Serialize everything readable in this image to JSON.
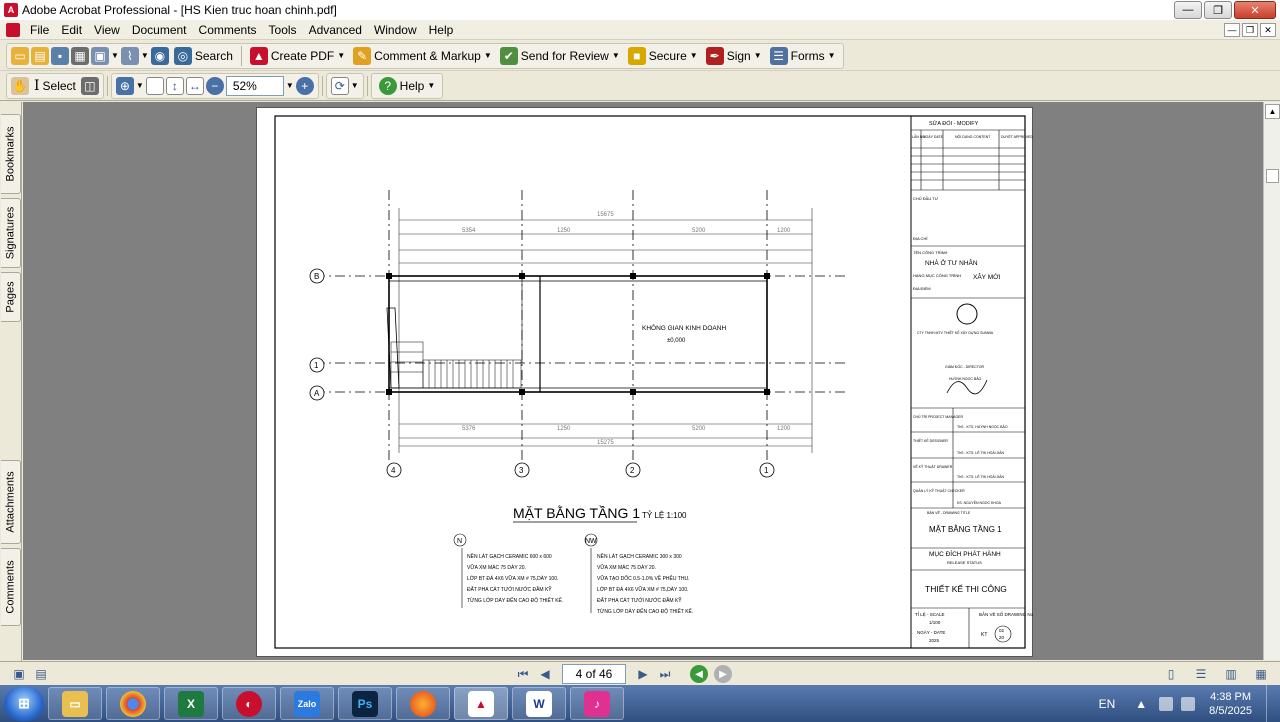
{
  "window": {
    "title": "Adobe Acrobat Professional - [HS Kien truc hoan chinh.pdf]",
    "min_glyph": "—",
    "max_glyph": "❐",
    "close_glyph": "✕"
  },
  "menu": [
    "File",
    "Edit",
    "View",
    "Document",
    "Comments",
    "Tools",
    "Advanced",
    "Window",
    "Help"
  ],
  "toolbar1": {
    "search": "Search",
    "create_pdf": "Create PDF",
    "comment_markup": "Comment & Markup",
    "send_review": "Send for Review",
    "secure": "Secure",
    "sign": "Sign",
    "forms": "Forms"
  },
  "toolbar2": {
    "select": "Select",
    "zoom_value": "52%",
    "help": "Help"
  },
  "left_tabs": [
    "Bookmarks",
    "Signatures",
    "Pages",
    "Attachments",
    "Comments"
  ],
  "status": {
    "page_indicator": "4 of 46"
  },
  "drawing": {
    "plan_title": "MẶT BẰNG TẦNG 1",
    "scale_label": "TỶ LỆ 1:100",
    "room_label": "KHÔNG GIAN KINH DOANH",
    "room_level": "±0,000",
    "total_dim_top": "15675",
    "total_dim_bottom": "15275",
    "dims_top": [
      "5354",
      "1250",
      "5200",
      "1200"
    ],
    "dims_bottom": [
      "5376",
      "1250",
      "5200",
      "1200"
    ],
    "axis_numbers": [
      "4",
      "3",
      "2",
      "1"
    ],
    "axis_letters": [
      "B",
      "1",
      "A"
    ],
    "legend_n_tag": "N",
    "legend_n": [
      "NỀN LÁT GẠCH CERAMIC 600 x 600",
      "VỮA XM MÁC 75 DÀY 20.",
      "LỚP BT ĐÁ 4X6 VỮA XM # 75,DÀY 100.",
      "ĐẤT PHA CÁT TƯỚI NƯỚC ĐẦM KỸ",
      "TỪNG LỚP DÀY ĐẾN CAO ĐỘ THIẾT KẾ."
    ],
    "legend_nw_tag": "NW",
    "legend_nw": [
      "NỀN LÁT GẠCH CERAMIC 300 x 300",
      "VỮA XM MÁC 75 DÀY 20.",
      "VỮA TẠO DỐC 0.5-1.0% VỀ PHỄU THU.",
      "LỚP BT ĐÁ 4X6 VỮA XM # 75,DÀY 100.",
      "ĐẤT PHA CÁT TƯỚI NƯỚC ĐẦM KỸ",
      "TỪNG LỚP DÀY ĐẾN CAO ĐỘ THIẾT KẾ."
    ]
  },
  "titleblock": {
    "revision_header": "SỬA ĐỔI - MODIFY",
    "rev_cols": [
      "LẦN NO",
      "NGÀY DATE",
      "NỘI DUNG CONTENT",
      "DUYỆT APPROVED"
    ],
    "chu_dau_tu": "CHỦ ĐẦU TƯ",
    "dia_chi": "ĐỊA CHỈ",
    "ten_cong_trinh": "TÊN CÔNG TRÌNH",
    "project_name": "NHÀ Ở TƯ NHÂN",
    "hang_muc": "HẠNG MỤC CÔNG TRÌNH",
    "hang_muc_value": "XÂY MỚI",
    "dia_diem": "ĐỊA ĐIỂM",
    "company": "CTY TNHH MTV THIẾT KẾ XÂY DỰNG SUNWA",
    "director": "GIÁM ĐỐC - DIRECTOR",
    "director_name": "HUỲNH NGỌC BẢO",
    "chu_tri": "CHỦ TRÌ PROJECT MANAGER",
    "chu_tri_name": "ThS - KTS. HUỲNH NGỌC BẢO",
    "thiet_ke": "THIẾT KẾ DESIGNER",
    "thiet_ke_name": "ThS - KTS. LÊ THỊ HOÀI DÂN",
    "ve_ky_thuat": "VẼ KỸ THUẬT DRAWER",
    "ve_ky_thuat_name": "ThS - KTS. LÊ THỊ HOÀI DÂN",
    "quan_ly": "QUẢN LÝ KỸ THUẬT CHECKER",
    "quan_ly_name": "KS. NGUYỄN NGỌC KHOA",
    "ban_ve": "BẢN VẼ - DRAWING TITLE",
    "drawing_title": "MẶT BẰNG TẦNG 1",
    "muc_dich": "MỤC ĐÍCH PHÁT HÀNH",
    "release": "RELEASE STATUS",
    "release_value": "THIẾT KẾ THI CÔNG",
    "scale": "TỈ LỆ - SCALE",
    "scale_value": "1/100",
    "date": "NGÀY - DATE",
    "date_value": "2025",
    "drawing_no": "BẢN VẼ SỐ DRAWING No",
    "drawing_code": "KT",
    "sheet": "02",
    "sheet_of": "20"
  },
  "taskbar": {
    "apps": [
      "explorer",
      "chrome",
      "excel",
      "acrobat-reader",
      "zalo",
      "photoshop",
      "firefox",
      "acrobat",
      "word",
      "app"
    ],
    "lang": "EN",
    "time": "4:38 PM",
    "date": "8/5/2025"
  },
  "colors": {
    "title_bg": "#ffffff",
    "toolbar_bg": "#ece9d8",
    "doc_bg": "#808080",
    "taskbar": "#2f4f80"
  }
}
